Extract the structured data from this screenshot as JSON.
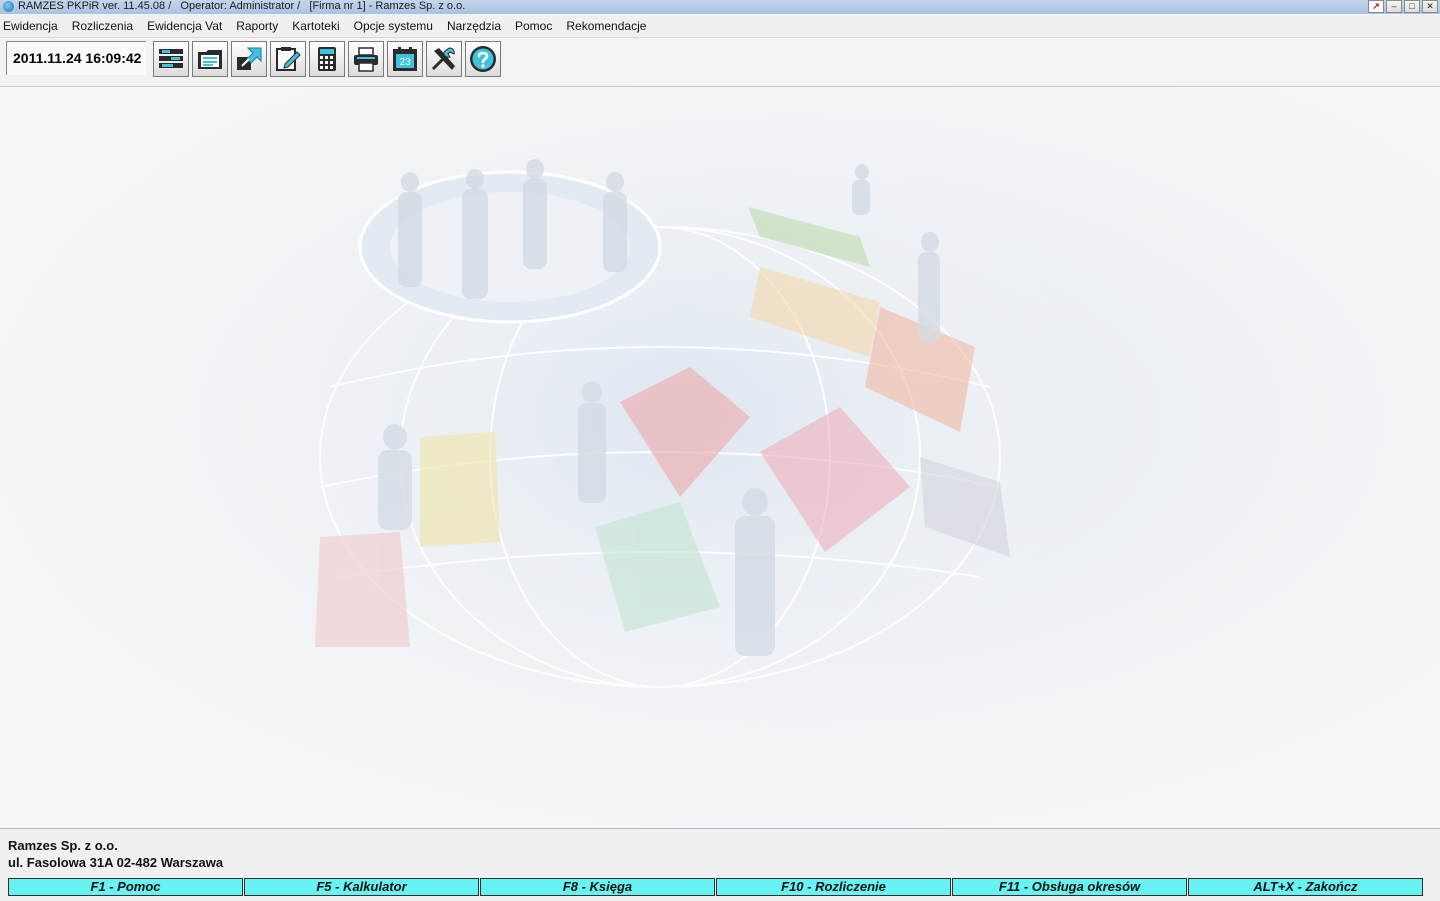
{
  "window": {
    "title": "RAMZES PKPiR ver. 11.45.08 /   Operator: Administrator /   [Firma nr 1] - Ramzes Sp. z o.o."
  },
  "menu": [
    {
      "label": "Ewidencja"
    },
    {
      "label": "Rozliczenia"
    },
    {
      "label": "Ewidencja Vat"
    },
    {
      "label": "Raporty"
    },
    {
      "label": "Kartoteki"
    },
    {
      "label": "Opcje systemu"
    },
    {
      "label": "Narzędzia"
    },
    {
      "label": "Pomoc"
    },
    {
      "label": "Rekomendacje"
    }
  ],
  "toolbar": {
    "datetime": "2011.11.24 16:09:42",
    "tools": [
      {
        "icon": "ledger-icon"
      },
      {
        "icon": "documents-icon"
      },
      {
        "icon": "import-export-icon"
      },
      {
        "icon": "edit-notes-icon"
      },
      {
        "icon": "calculator-icon"
      },
      {
        "icon": "printer-icon"
      },
      {
        "icon": "calendar-icon"
      },
      {
        "icon": "tools-icon"
      },
      {
        "icon": "help-icon"
      }
    ],
    "calendar_day": "23"
  },
  "footer": {
    "company_name": "Ramzes Sp. z o.o.",
    "address": "ul. Fasolowa 31A  02-482 Warszawa",
    "fkeys": [
      {
        "label": "F1 - Pomoc"
      },
      {
        "label": "F5 - Kalkulator"
      },
      {
        "label": "F8 - Księga"
      },
      {
        "label": "F10 - Rozliczenie"
      },
      {
        "label": "F11 - Obsługa okresów"
      },
      {
        "label": "ALT+X - Zakończ"
      }
    ]
  },
  "colors": {
    "fkey_bg": "#66f3f2",
    "titlebar": "#b8cde8"
  }
}
